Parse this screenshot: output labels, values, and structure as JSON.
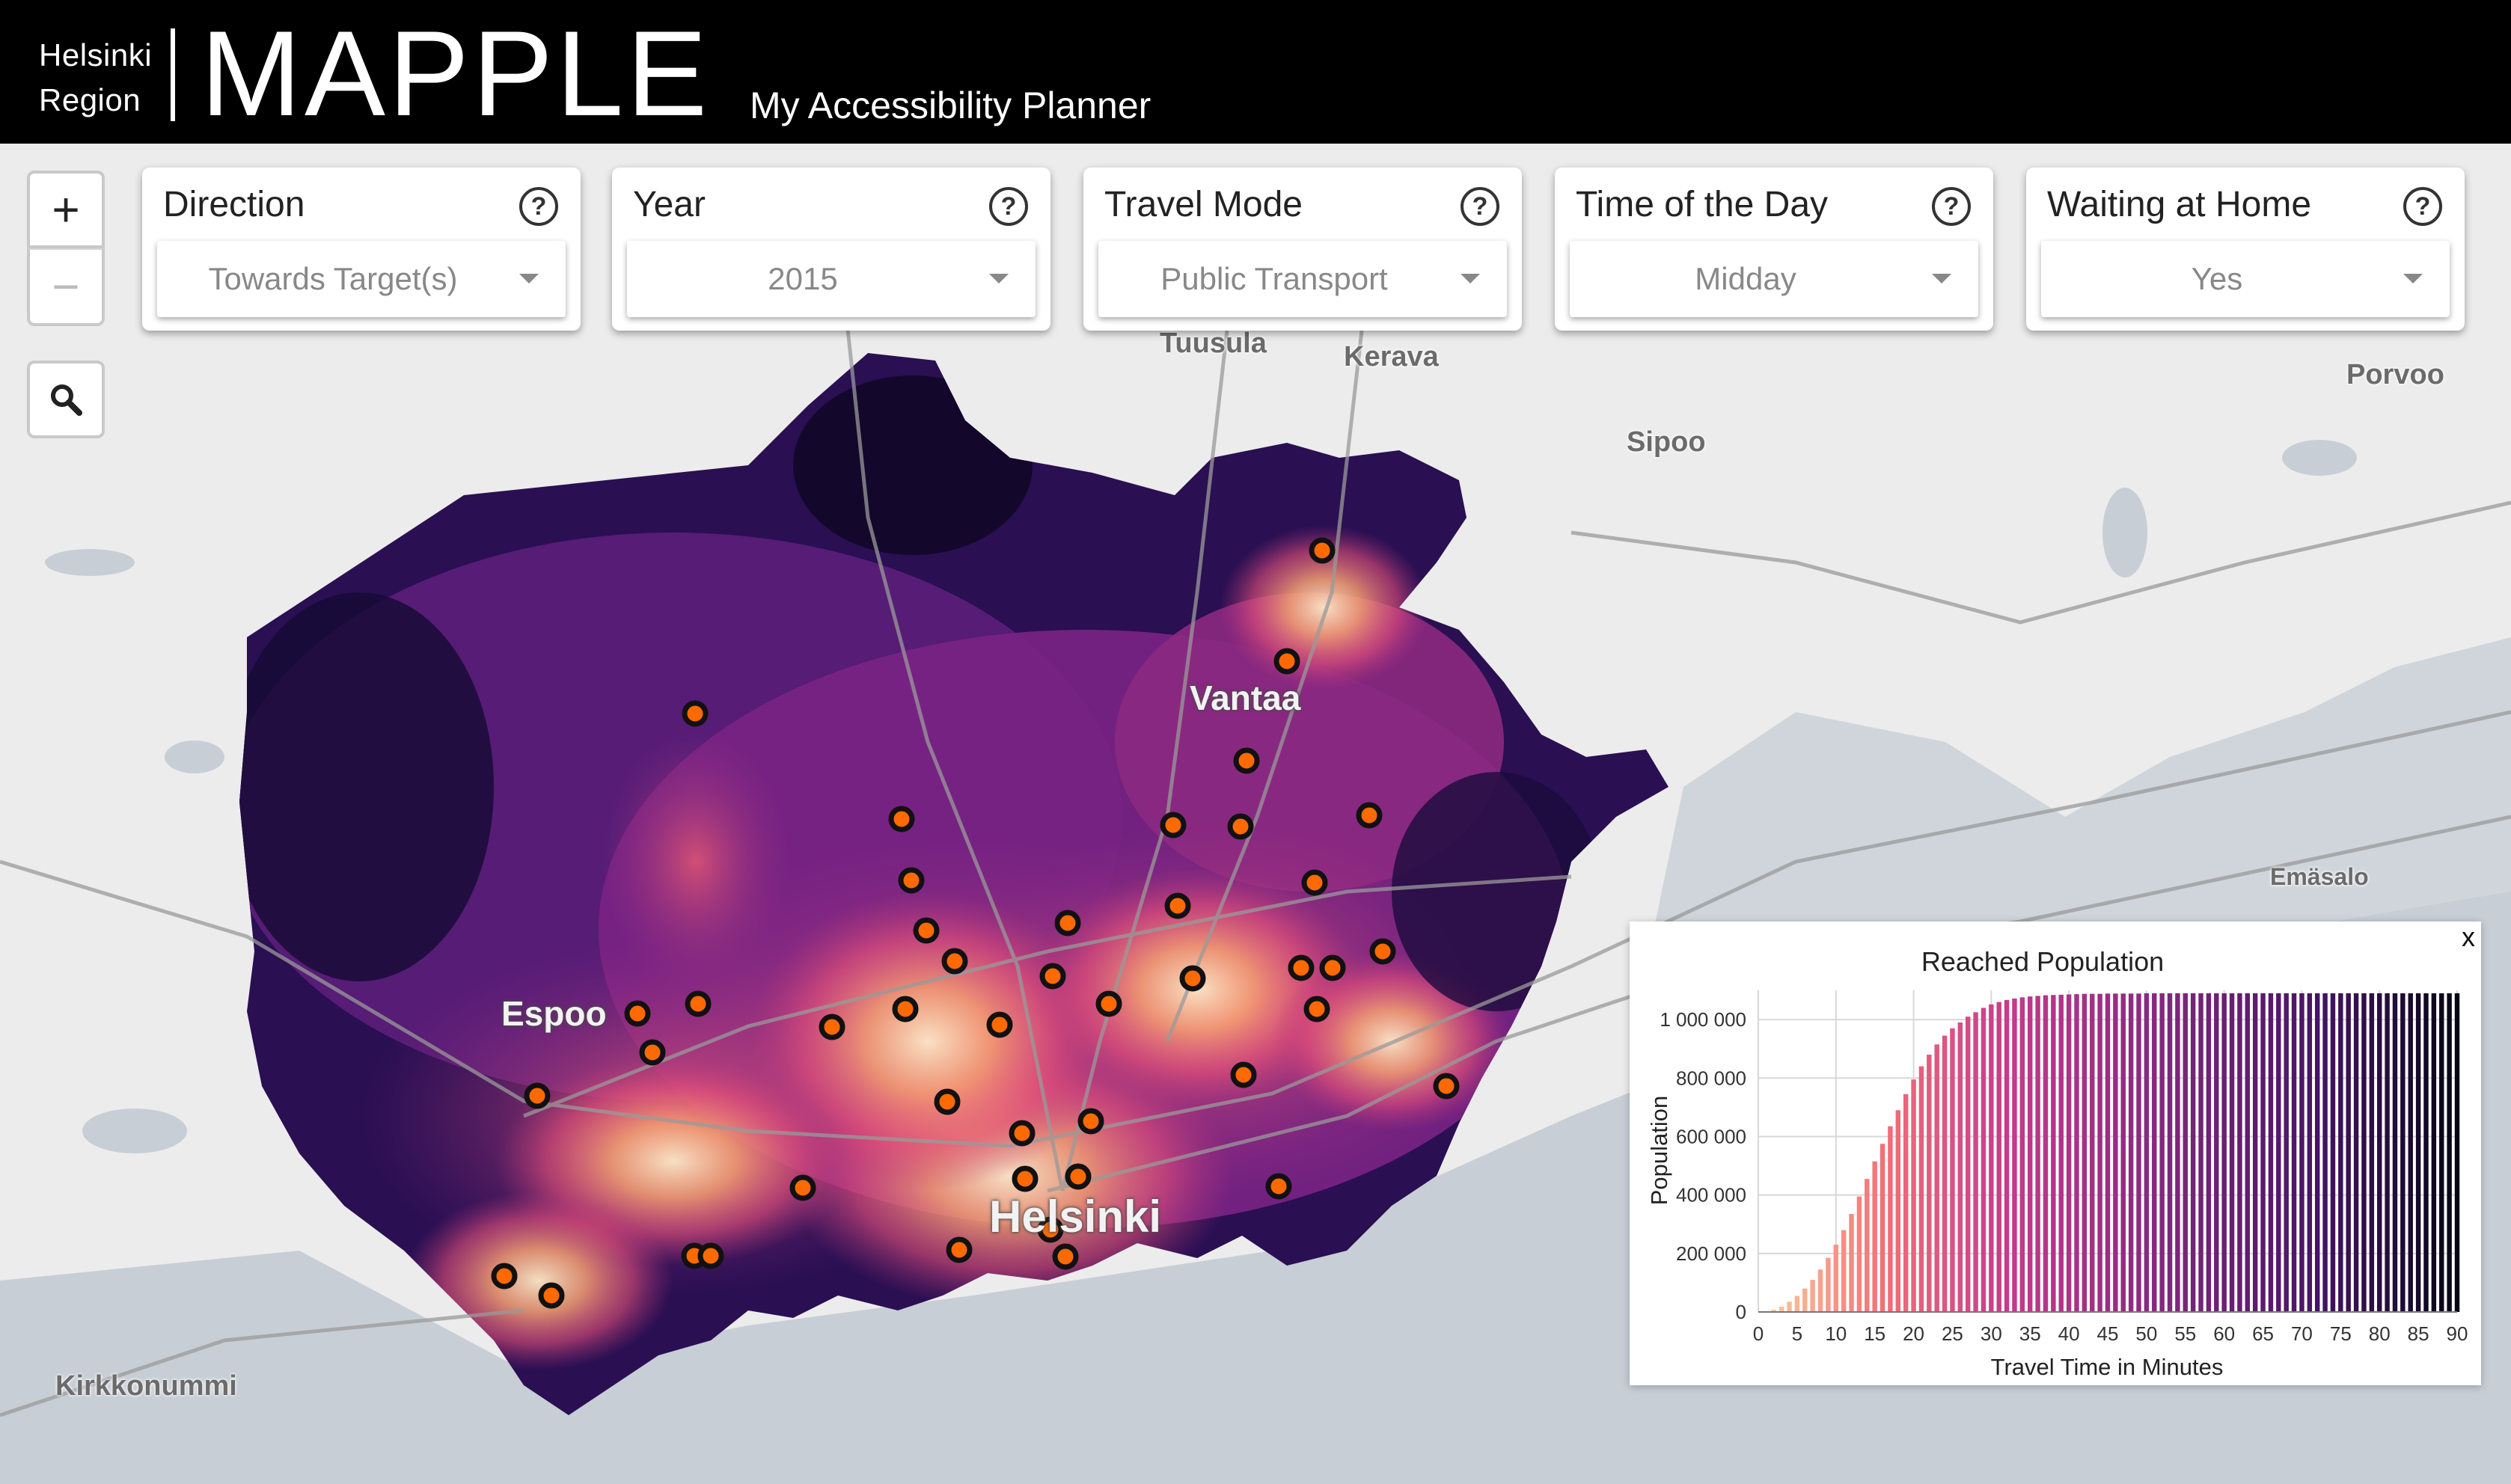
{
  "header": {
    "region_line1": "Helsinki",
    "region_line2": "Region",
    "title": "MAPPLE",
    "subtitle": "My Accessibility Planner"
  },
  "controls": [
    {
      "title": "Direction",
      "value": "Towards Target(s)",
      "help": "?"
    },
    {
      "title": "Year",
      "value": "2015",
      "help": "?"
    },
    {
      "title": "Travel Mode",
      "value": "Public Transport",
      "help": "?"
    },
    {
      "title": "Time of the Day",
      "value": "Midday",
      "help": "?"
    },
    {
      "title": "Waiting at Home",
      "value": "Yes",
      "help": "?"
    }
  ],
  "map_buttons": {
    "zoom_in": "+",
    "zoom_out": "−",
    "search_icon": "search-icon"
  },
  "places": {
    "tuusula": "Tuusula",
    "kerava": "Kerava",
    "porvoo": "Porvoo",
    "sipoo": "Sipoo",
    "vantaa": "Vantaa",
    "espoo": "Espoo",
    "helsinki": "Helsinki",
    "emasalo": "Emäsalo",
    "kirkkonummi": "Kirkkonummi"
  },
  "colors": {
    "header_bg": "#000000",
    "map_bg": "#e6e8eb",
    "water": "#c8ced6",
    "marker_fill": "#ff6a00",
    "marker_ring": "#111111",
    "heat_low": "#1b0c41",
    "heat_mid": "#8c2981",
    "heat_high": "#fcfdbf"
  },
  "chart_popup": {
    "close_label": "x"
  },
  "chart_data": {
    "type": "bar",
    "title": "Reached Population",
    "xlabel": "Travel Time in Minutes",
    "ylabel": "Population",
    "x_ticks": [
      0,
      5,
      10,
      15,
      20,
      25,
      30,
      35,
      40,
      45,
      50,
      55,
      60,
      65,
      70,
      75,
      80,
      85,
      90
    ],
    "y_ticks": [
      "0",
      "200 000",
      "400 000",
      "600 000",
      "800 000",
      "1 000 000"
    ],
    "xlim": [
      0,
      90
    ],
    "ylim": [
      0,
      1100000
    ],
    "x": [
      1,
      2,
      3,
      4,
      5,
      6,
      7,
      8,
      9,
      10,
      11,
      12,
      13,
      14,
      15,
      16,
      17,
      18,
      19,
      20,
      21,
      22,
      23,
      24,
      25,
      26,
      27,
      28,
      29,
      30,
      31,
      32,
      33,
      34,
      35,
      36,
      37,
      38,
      39,
      40,
      41,
      42,
      43,
      44,
      45,
      46,
      47,
      48,
      49,
      50,
      51,
      52,
      53,
      54,
      55,
      56,
      57,
      58,
      59,
      60,
      61,
      62,
      63,
      64,
      65,
      66,
      67,
      68,
      69,
      70,
      71,
      72,
      73,
      74,
      75,
      76,
      77,
      78,
      79,
      80,
      81,
      82,
      83,
      84,
      85,
      86,
      87,
      88,
      89,
      90
    ],
    "values": [
      2000,
      8000,
      18000,
      35000,
      55000,
      80000,
      110000,
      145000,
      185000,
      230000,
      280000,
      335000,
      395000,
      455000,
      515000,
      575000,
      635000,
      690000,
      745000,
      795000,
      840000,
      880000,
      915000,
      945000,
      970000,
      990000,
      1010000,
      1025000,
      1040000,
      1052000,
      1060000,
      1067000,
      1072000,
      1076000,
      1079000,
      1081000,
      1083000,
      1084000,
      1085000,
      1086000,
      1087000,
      1088000,
      1088000,
      1088000,
      1089000,
      1089000,
      1089000,
      1089000,
      1089000,
      1090000,
      1090000,
      1090000,
      1090000,
      1090000,
      1090000,
      1090000,
      1090000,
      1090000,
      1090000,
      1090000,
      1090000,
      1090000,
      1090000,
      1090000,
      1090000,
      1090000,
      1090000,
      1090000,
      1090000,
      1090000,
      1090000,
      1090000,
      1090000,
      1090000,
      1090000,
      1090000,
      1090000,
      1090000,
      1090000,
      1090000,
      1090000,
      1090000,
      1090000,
      1090000,
      1090000,
      1090000,
      1090000,
      1090000,
      1090000,
      1090000
    ],
    "grid": true
  }
}
